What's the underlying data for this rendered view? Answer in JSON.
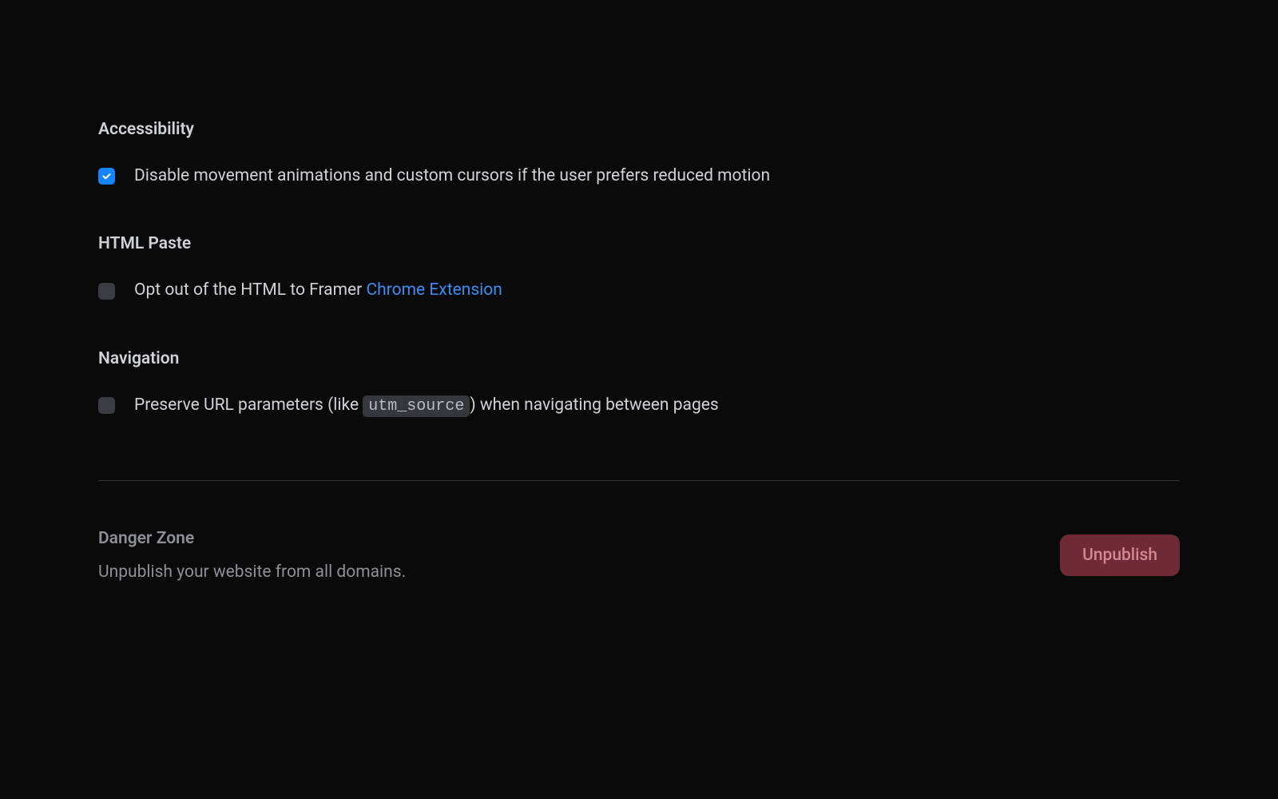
{
  "accessibility": {
    "title": "Accessibility",
    "checkbox_label": "Disable movement animations and custom cursors if the user prefers reduced motion",
    "checked": true
  },
  "html_paste": {
    "title": "HTML Paste",
    "checkbox_label_prefix": "Opt out of the HTML to Framer ",
    "link_text": "Chrome Extension",
    "checked": false
  },
  "navigation": {
    "title": "Navigation",
    "checkbox_label_prefix": "Preserve URL parameters (like ",
    "code_text": "utm_source",
    "checkbox_label_suffix": ") when navigating between pages",
    "checked": false
  },
  "danger_zone": {
    "title": "Danger Zone",
    "description": "Unpublish your website from all domains.",
    "button_label": "Unpublish"
  }
}
